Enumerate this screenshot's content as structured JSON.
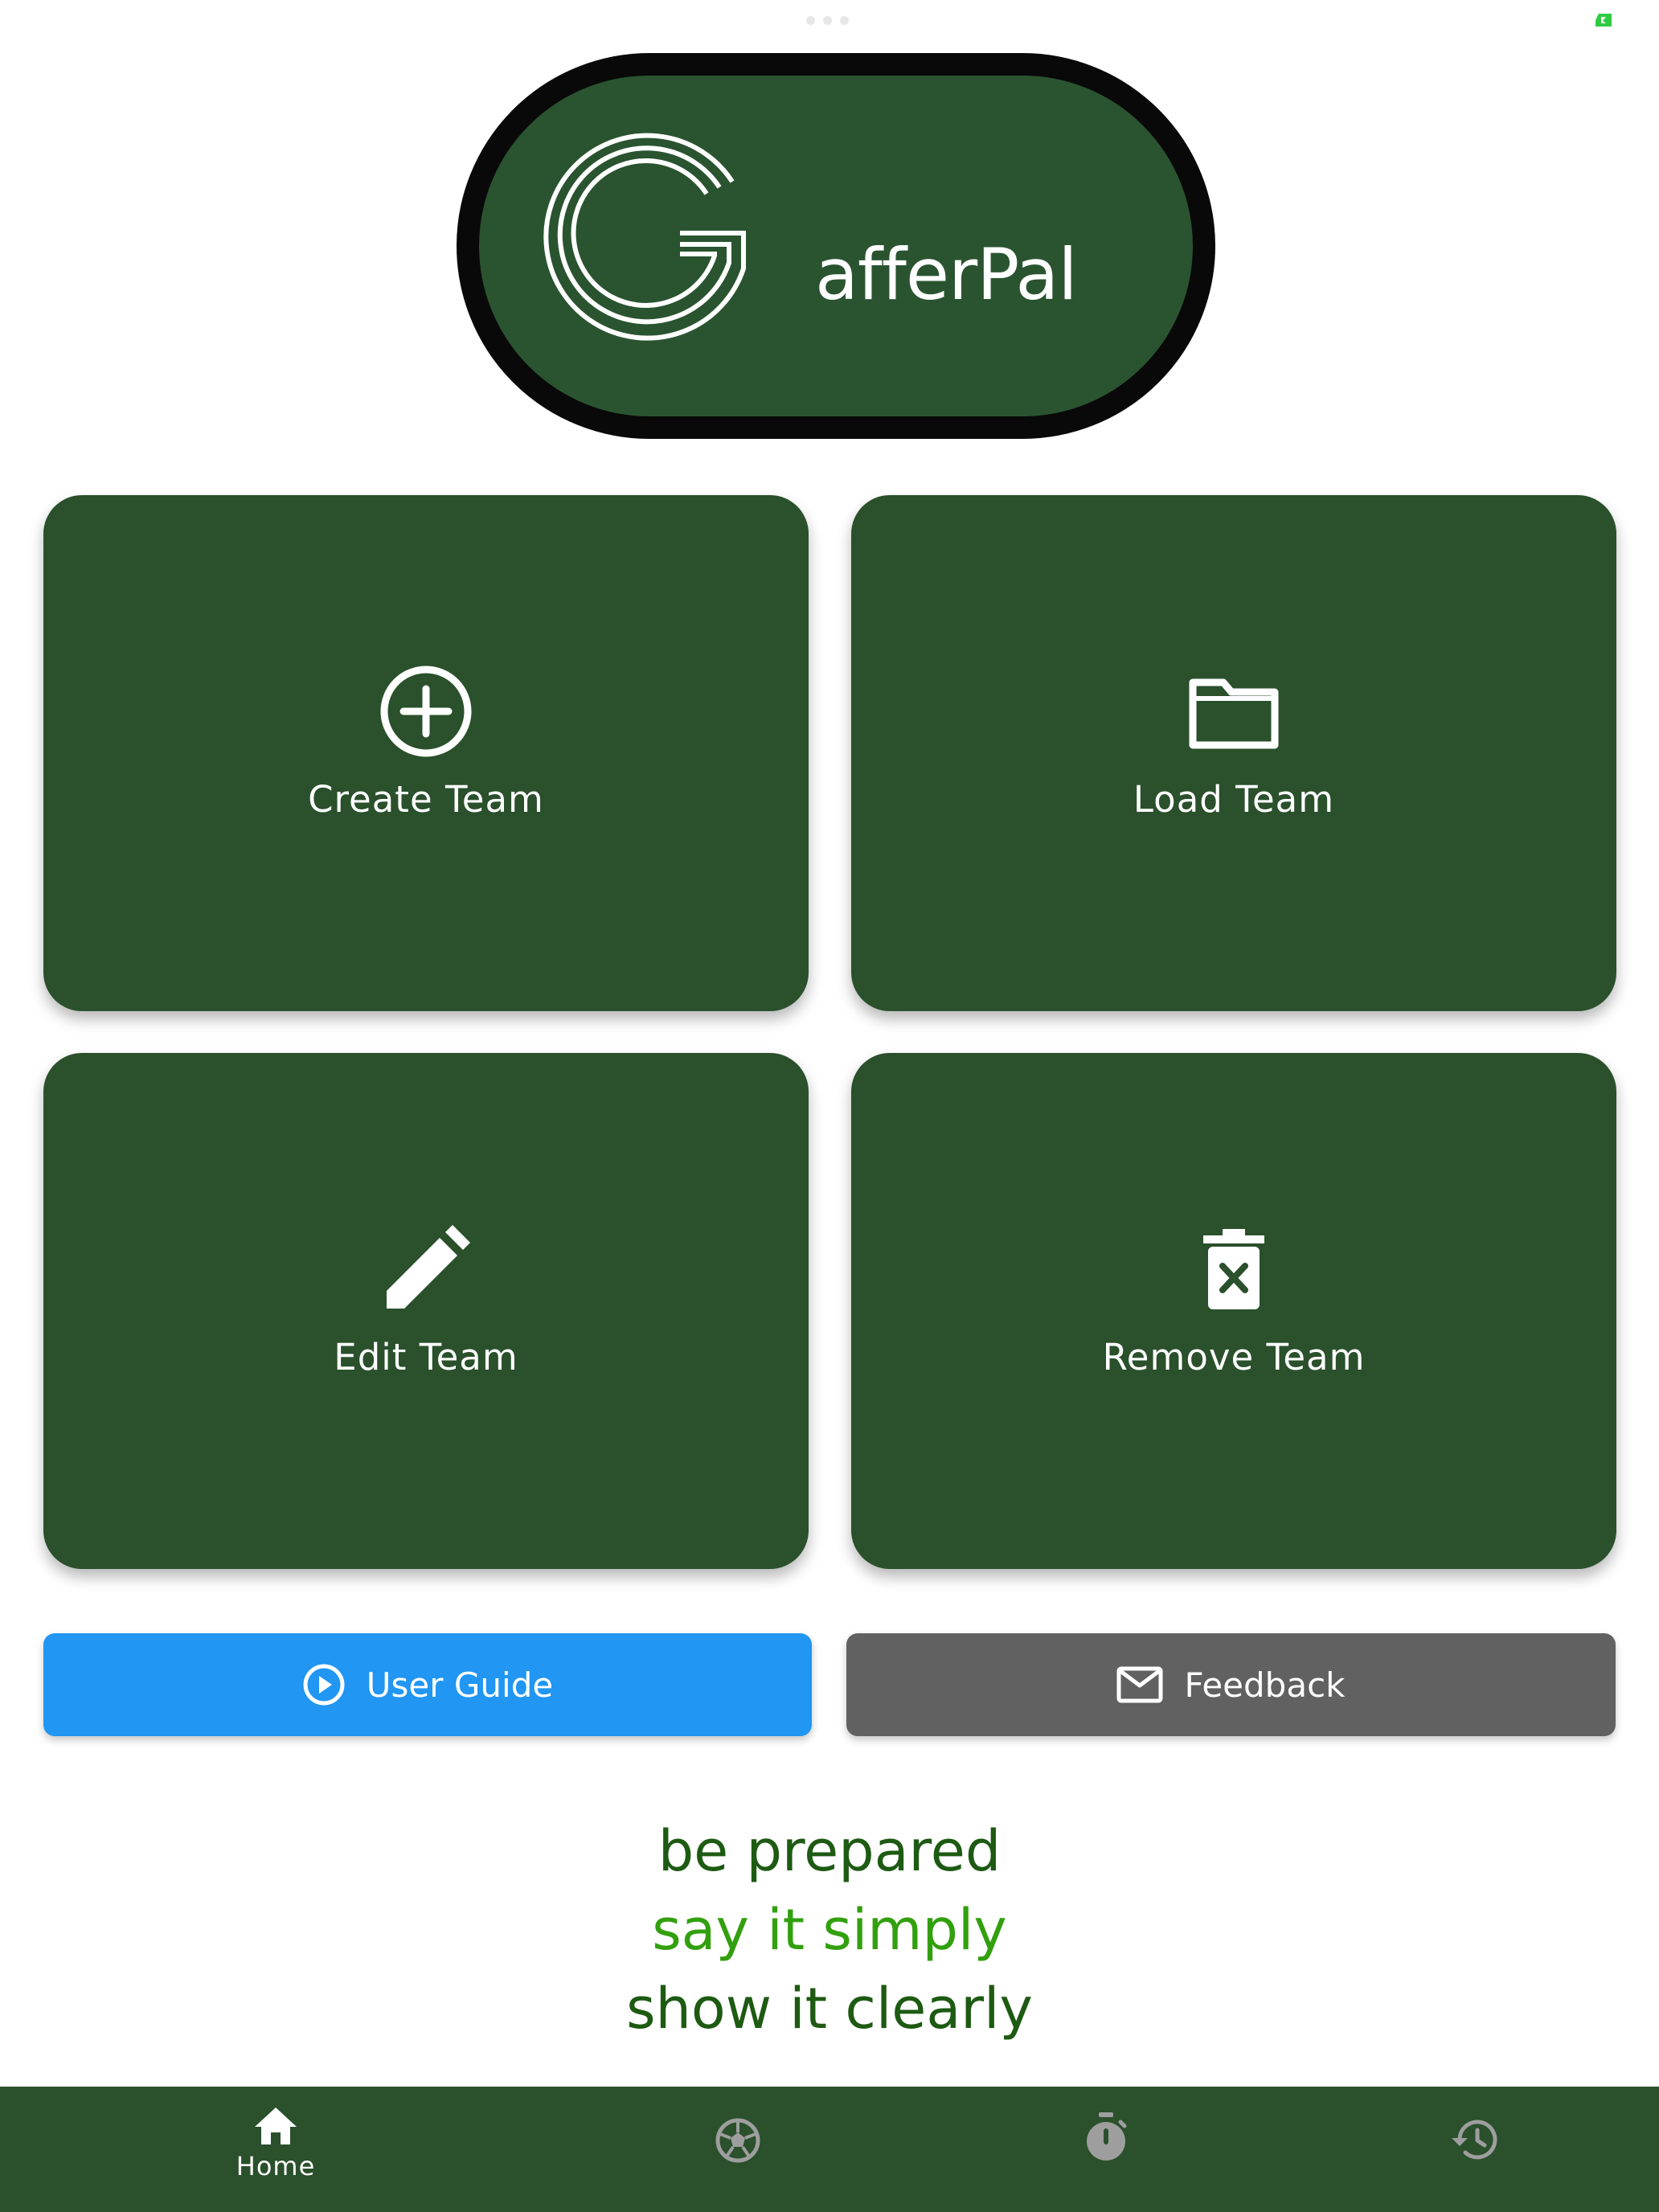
{
  "logo": {
    "text": "afferPal",
    "initial": "G"
  },
  "tiles": [
    {
      "label": "Create Team",
      "icon": "add-circle-icon"
    },
    {
      "label": "Load Team",
      "icon": "folder-icon"
    },
    {
      "label": "Edit Team",
      "icon": "pencil-icon"
    },
    {
      "label": "Remove Team",
      "icon": "delete-icon"
    }
  ],
  "buttons": {
    "user_guide": {
      "label": "User Guide",
      "icon": "play-circle-icon",
      "color": "#2196f3"
    },
    "feedback": {
      "label": "Feedback",
      "icon": "mail-icon",
      "color": "#616161"
    }
  },
  "taglines": [
    "be prepared",
    "say it simply",
    "show it clearly"
  ],
  "nav": {
    "items": [
      {
        "label": "Home",
        "icon": "home-icon",
        "active": true
      },
      {
        "label": "",
        "icon": "soccer-ball-icon",
        "active": false
      },
      {
        "label": "",
        "icon": "stopwatch-icon",
        "active": false
      },
      {
        "label": "",
        "icon": "history-icon",
        "active": false
      }
    ]
  },
  "colors": {
    "primary_green": "#2a502c",
    "tagline_dark": "#1d5a12",
    "tagline_light": "#32a00e"
  }
}
